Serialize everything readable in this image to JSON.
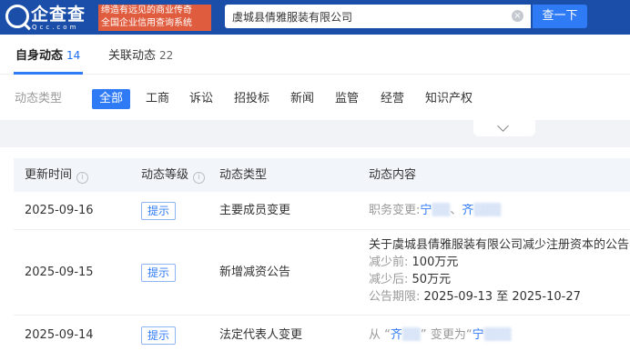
{
  "header": {
    "logo_text": "企查查",
    "logo_domain": "Qcc.com",
    "slogan_line1": "缔造有远见的商业传奇",
    "slogan_line2": "全国企业信用查询系统",
    "search_value": "虞城县倩雅服装有限公司",
    "clear_symbol": "×",
    "search_button": "查一下"
  },
  "tabs": [
    {
      "label": "自身动态",
      "count": "14",
      "active": true
    },
    {
      "label": "关联动态",
      "count": "22",
      "active": false
    }
  ],
  "filter": {
    "label": "动态类型",
    "chips": [
      "全部",
      "工商",
      "诉讼",
      "招投标",
      "新闻",
      "监管",
      "经营",
      "知识产权"
    ],
    "selected": "全部"
  },
  "table": {
    "headers": [
      "更新时间",
      "动态等级",
      "动态类型",
      "动态内容"
    ],
    "info_symbol": "i",
    "rows": [
      {
        "date": "2025-09-16",
        "level": "提示",
        "type": "主要成员变更",
        "content": {
          "prefix": "职务变更:",
          "name1": "宁",
          "name1_masked": "▒▒",
          "separator": "、",
          "name2": "齐",
          "name2_masked": "▒▒▒"
        }
      },
      {
        "date": "2025-09-15",
        "level": "提示",
        "type": "新增减资公告",
        "content": {
          "title": "关于虞城县倩雅服装有限公司减少注册资本的公告",
          "before_label": "减少前:",
          "before_value": "100万元",
          "after_label": "减少后:",
          "after_value": "50万元",
          "period_label": "公告期限:",
          "period_value": "2025-09-13 至 2025-10-27"
        }
      },
      {
        "date": "2025-09-14",
        "level": "提示",
        "type": "法定代表人变更",
        "content": {
          "from_label": "从",
          "lquote1": "“",
          "name_from": "齐",
          "name_from_masked": "▒▒",
          "rquote1": "”",
          "change_label": "变更为",
          "lquote2": "“",
          "name_to": "宁",
          "name_to_masked": "▒▒▒"
        }
      }
    ]
  },
  "colors": {
    "header_bg": "#1a4ea8",
    "slogan_bg": "#e05c3e",
    "accent": "#2f7bf5"
  }
}
